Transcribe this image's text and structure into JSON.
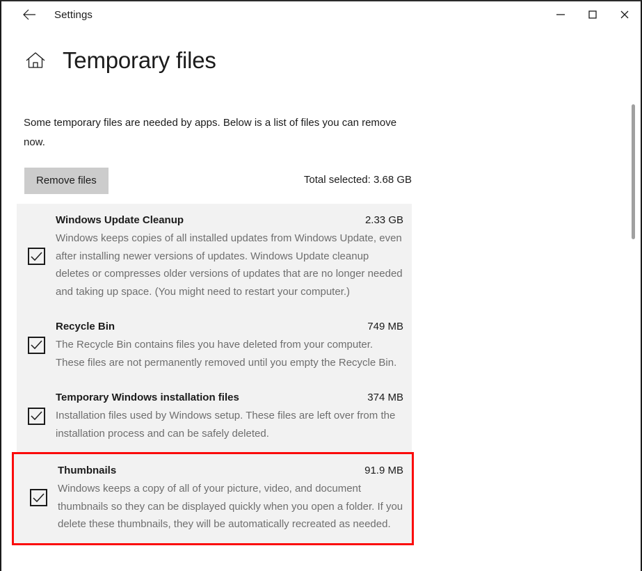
{
  "window": {
    "title": "Settings",
    "back_icon": "back-arrow-icon",
    "minimize_label": "─",
    "maximize_label": "□",
    "close_label": "✕"
  },
  "page": {
    "home_icon": "home-icon",
    "title": "Temporary files",
    "intro": "Some temporary files are needed by apps. Below is a list of files you can remove now."
  },
  "actions": {
    "remove_label": "Remove files",
    "total_selected": "Total selected: 3.68 GB"
  },
  "colors": {
    "panel_bg": "#f2f2f2",
    "button_bg": "#cccccc",
    "highlight_border": "#fb0b0b",
    "text": "#1b1b1b",
    "muted_text": "#6e6e6e",
    "scrollbar": "#a0a0a0"
  },
  "file_items": [
    {
      "name": "Windows Update Cleanup",
      "size": "2.33 GB",
      "description": "Windows keeps copies of all installed updates from Windows Update, even after installing newer versions of updates. Windows Update cleanup deletes or compresses older versions of updates that are no longer needed and taking up space. (You might need to restart your computer.)",
      "checked": true,
      "highlighted": false
    },
    {
      "name": "Recycle Bin",
      "size": "749 MB",
      "description": "The Recycle Bin contains files you have deleted from your computer. These files are not permanently removed until you empty the Recycle Bin.",
      "checked": true,
      "highlighted": false
    },
    {
      "name": "Temporary Windows installation files",
      "size": "374 MB",
      "description": "Installation files used by Windows setup.  These files are left over from the installation process and can be safely deleted.",
      "checked": true,
      "highlighted": false
    },
    {
      "name": "Thumbnails",
      "size": "91.9 MB",
      "description": "Windows keeps a copy of all of your picture, video, and document thumbnails so they can be displayed quickly when you open a folder. If you delete these thumbnails, they will be automatically recreated as needed.",
      "checked": true,
      "highlighted": true
    }
  ]
}
